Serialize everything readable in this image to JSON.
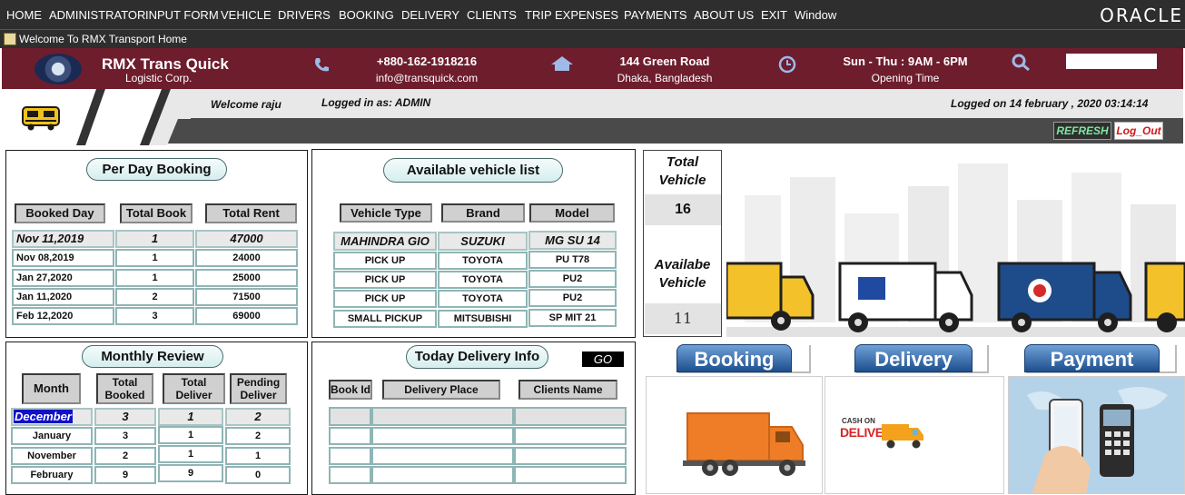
{
  "menu": [
    "HOME",
    "ADMINISTRATOR",
    "INPUT FORM",
    "VEHICLE",
    "DRIVERS",
    "BOOKING",
    "DELIVERY",
    "CLIENTS",
    "TRIP EXPENSES",
    "PAYMENTS",
    "ABOUT US",
    "EXIT",
    "Window"
  ],
  "brand_logo": "ORACLE",
  "window_title": "Welcome To RMX Transport Home",
  "header": {
    "company": "RMX Trans Quick",
    "company_sub": "Logistic Corp.",
    "phone": "+880-162-1918216",
    "email": "info@transquick.com",
    "address1": "144 Green Road",
    "address2": "Dhaka, Bangladesh",
    "hours": "Sun - Thu : 9AM - 6PM",
    "hours_label": "Opening Time",
    "icons": [
      "phone-icon",
      "home-icon",
      "clock-icon",
      "search-icon"
    ]
  },
  "session": {
    "welcome": "Welcome raju",
    "logged_as": "Logged in as: ADMIN",
    "logged_on": "Logged on 14 february , 2020 03:14:14",
    "refresh": "REFRESH",
    "logout": "Log_Out"
  },
  "per_day": {
    "title": "Per Day Booking",
    "headers": [
      "Booked Day",
      "Total Book",
      "Total Rent"
    ],
    "rows": [
      [
        "Nov 11,2019",
        "1",
        "47000"
      ],
      [
        "Nov 08,2019",
        "1",
        "24000"
      ],
      [
        "Jan 27,2020",
        "1",
        "25000"
      ],
      [
        "Jan 11,2020",
        "2",
        "71500"
      ],
      [
        "Feb 12,2020",
        "3",
        "69000"
      ]
    ]
  },
  "vehicles": {
    "title": "Available vehicle list",
    "headers": [
      "Vehicle Type",
      "Brand",
      "Model"
    ],
    "rows": [
      [
        "MAHINDRA GIO",
        "SUZUKI",
        "MG SU 14"
      ],
      [
        "PICK UP",
        "TOYOTA",
        "PU T78"
      ],
      [
        "PICK UP",
        "TOYOTA",
        "PU2"
      ],
      [
        "PICK UP",
        "TOYOTA",
        "PU2"
      ],
      [
        "SMALL PICKUP",
        "MITSUBISHI",
        "SP MIT 21"
      ]
    ]
  },
  "stats": {
    "total_label_1": "Total",
    "total_label_2": "Vehicle",
    "total_value": "16",
    "avail_label_1": "Availabe",
    "avail_label_2": "Vehicle",
    "avail_value": "11"
  },
  "monthly": {
    "title": "Monthly Review",
    "headers": [
      "Month",
      "Total Booked",
      "Total Deliver",
      "Pending Deliver"
    ],
    "rows": [
      [
        "December",
        "3",
        "1",
        "2"
      ],
      [
        "January",
        "3",
        "1",
        "2"
      ],
      [
        "November",
        "2",
        "1",
        "1"
      ],
      [
        "February",
        "9",
        "9",
        "0"
      ]
    ]
  },
  "delivery": {
    "title": "Today Delivery Info",
    "go": "GO",
    "headers": [
      "Book Id",
      "Delivery Place",
      "Clients Name"
    ]
  },
  "actions": {
    "booking": "Booking",
    "delivery": "Delivery",
    "payment": "Payment"
  },
  "cod_label_1": "CASH ON",
  "cod_label_2": "DELIVERY",
  "colors": {
    "menubar": "#2e2e2e",
    "header": "#6e1d2d",
    "accent_blue": "#1d4f8e",
    "cell_border": "#8fb5b5"
  }
}
